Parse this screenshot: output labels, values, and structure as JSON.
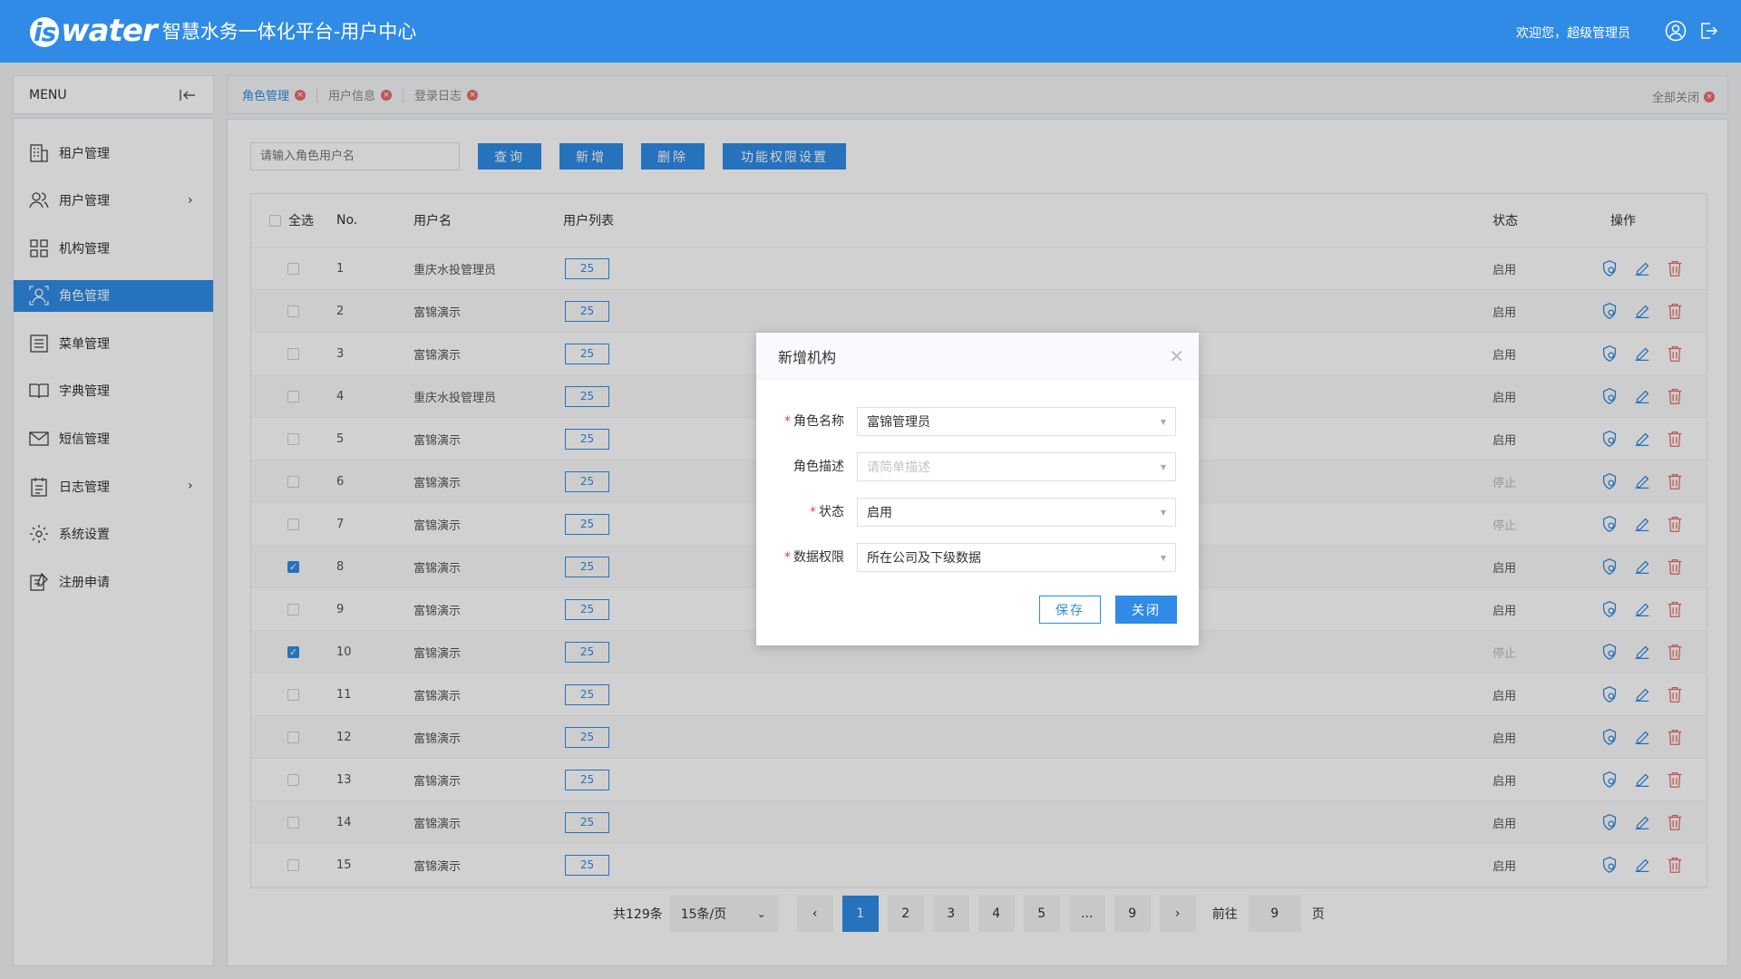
{
  "header": {
    "logo_text": "iswater",
    "title": "智慧水务一体化平台-用户中心",
    "welcome": "欢迎您，超级管理员"
  },
  "sidebar": {
    "menu_label": "MENU",
    "items": [
      {
        "label": "租户管理",
        "icon": "tenant-icon",
        "active": false,
        "has_arrow": false
      },
      {
        "label": "用户管理",
        "icon": "users-icon",
        "active": false,
        "has_arrow": true
      },
      {
        "label": "机构管理",
        "icon": "org-icon",
        "active": false,
        "has_arrow": false
      },
      {
        "label": "角色管理",
        "icon": "role-icon",
        "active": true,
        "has_arrow": false
      },
      {
        "label": "菜单管理",
        "icon": "menu-list-icon",
        "active": false,
        "has_arrow": false
      },
      {
        "label": "字典管理",
        "icon": "dictionary-icon",
        "active": false,
        "has_arrow": false
      },
      {
        "label": "短信管理",
        "icon": "sms-icon",
        "active": false,
        "has_arrow": false
      },
      {
        "label": "日志管理",
        "icon": "log-icon",
        "active": false,
        "has_arrow": true
      },
      {
        "label": "系统设置",
        "icon": "settings-icon",
        "active": false,
        "has_arrow": false
      },
      {
        "label": "注册申请",
        "icon": "register-icon",
        "active": false,
        "has_arrow": false
      }
    ]
  },
  "tabs": {
    "items": [
      {
        "label": "角色管理",
        "active": true
      },
      {
        "label": "用户信息",
        "active": false
      },
      {
        "label": "登录日志",
        "active": false
      }
    ],
    "close_all": "全部关闭"
  },
  "toolbar": {
    "search_placeholder": "请输入角色用户名",
    "query": "查询",
    "add": "新增",
    "delete": "删除",
    "perm": "功能权限设置"
  },
  "table": {
    "headers": {
      "select_all": "全选",
      "no": "No.",
      "name": "用户名",
      "list": "用户列表",
      "status": "状态",
      "ops": "操作"
    },
    "rows": [
      {
        "no": "1",
        "name": "重庆水投管理员",
        "count": "25",
        "status": "启用",
        "checked": false
      },
      {
        "no": "2",
        "name": "富锦演示",
        "count": "25",
        "status": "启用",
        "checked": false
      },
      {
        "no": "3",
        "name": "富锦演示",
        "count": "25",
        "status": "启用",
        "checked": false
      },
      {
        "no": "4",
        "name": "重庆水投管理员",
        "count": "25",
        "status": "启用",
        "checked": false
      },
      {
        "no": "5",
        "name": "富锦演示",
        "count": "25",
        "status": "启用",
        "checked": false
      },
      {
        "no": "6",
        "name": "富锦演示",
        "count": "25",
        "status": "停止",
        "checked": false
      },
      {
        "no": "7",
        "name": "富锦演示",
        "count": "25",
        "status": "停止",
        "checked": false
      },
      {
        "no": "8",
        "name": "富锦演示",
        "count": "25",
        "status": "启用",
        "checked": true
      },
      {
        "no": "9",
        "name": "富锦演示",
        "count": "25",
        "status": "启用",
        "checked": false
      },
      {
        "no": "10",
        "name": "富锦演示",
        "count": "25",
        "status": "停止",
        "checked": true
      },
      {
        "no": "11",
        "name": "富锦演示",
        "count": "25",
        "status": "启用",
        "checked": false
      },
      {
        "no": "12",
        "name": "富锦演示",
        "count": "25",
        "status": "启用",
        "checked": false
      },
      {
        "no": "13",
        "name": "富锦演示",
        "count": "25",
        "status": "启用",
        "checked": false
      },
      {
        "no": "14",
        "name": "富锦演示",
        "count": "25",
        "status": "启用",
        "checked": false
      },
      {
        "no": "15",
        "name": "富锦演示",
        "count": "25",
        "status": "启用",
        "checked": false
      }
    ]
  },
  "pager": {
    "total": "共129条",
    "page_size": "15条/页",
    "pages": [
      "1",
      "2",
      "3",
      "4",
      "5",
      "...",
      "9"
    ],
    "current": "1",
    "goto_label": "前往",
    "goto_value": "9",
    "page_unit": "页"
  },
  "modal": {
    "title": "新增机构",
    "fields": [
      {
        "label": "角色名称",
        "required": true,
        "value": "富锦管理员",
        "placeholder": false
      },
      {
        "label": "角色描述",
        "required": false,
        "value": "请简单描述",
        "placeholder": true
      },
      {
        "label": "状态",
        "required": true,
        "value": "启用",
        "placeholder": false
      },
      {
        "label": "数据权限",
        "required": true,
        "value": "所在公司及下级数据",
        "placeholder": false
      }
    ],
    "save": "保存",
    "close": "关闭"
  },
  "colors": {
    "primary": "#2f8be6",
    "danger": "#e86b6b"
  }
}
